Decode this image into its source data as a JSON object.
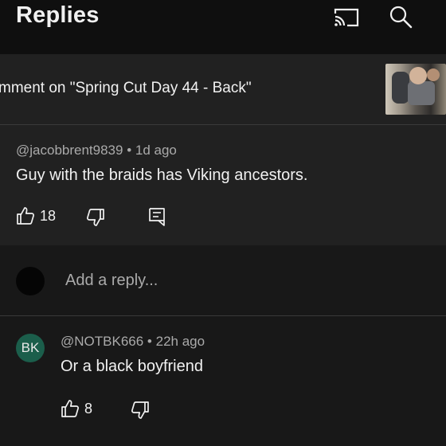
{
  "header": {
    "title": "Replies",
    "cast_icon": "cast-icon",
    "search_icon": "search-icon"
  },
  "context": {
    "text": "mment on \"Spring Cut Day 44 - Back\""
  },
  "parent_comment": {
    "author": "@jacobbrent9839",
    "time": "1d ago",
    "text": "Guy with the braids has Viking ancestors.",
    "likes": "18"
  },
  "reply_input": {
    "placeholder": "Add a reply..."
  },
  "reply": {
    "avatar_initials": "BK",
    "avatar_color": "#1b5e4b",
    "author": "@NOTBK666",
    "time": "22h ago",
    "text": "Or a black boyfriend",
    "likes": "8"
  }
}
